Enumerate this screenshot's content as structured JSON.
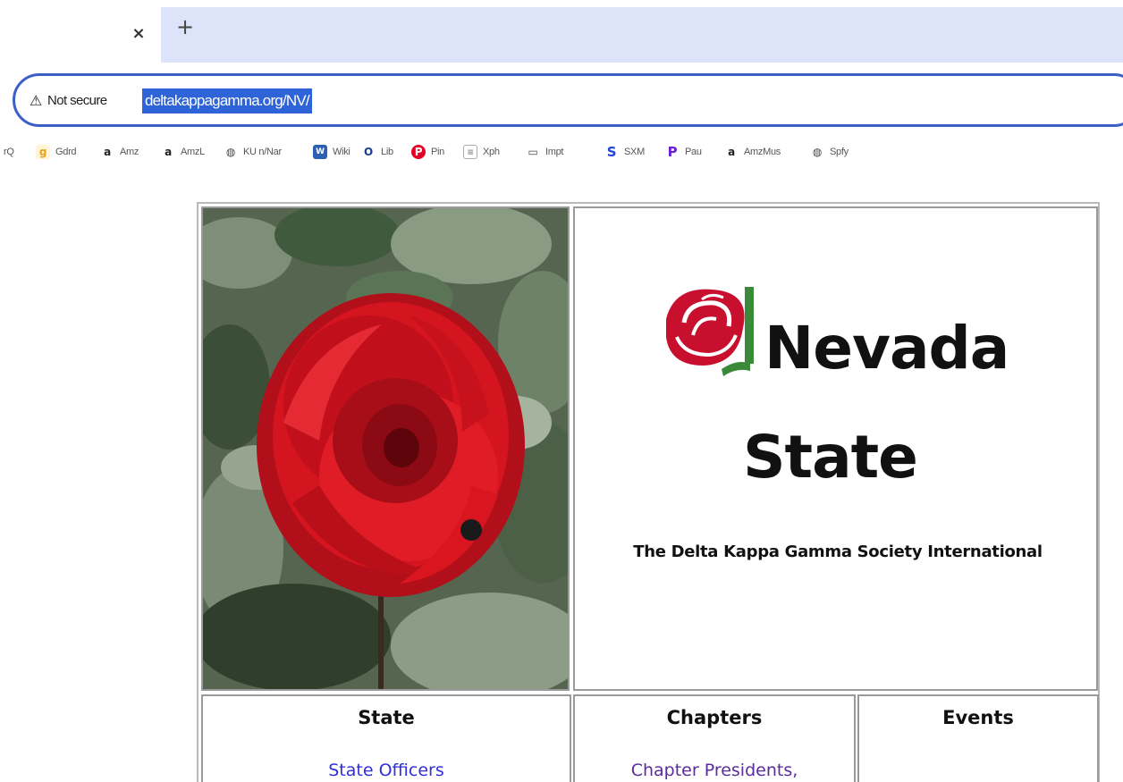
{
  "browser": {
    "tab": {
      "close_glyph": "×",
      "new_tab_glyph": "+"
    },
    "omnibox": {
      "security_icon": "warning-triangle-icon",
      "security_label": "Not secure",
      "url": "deltakappagamma.org/NV/"
    },
    "bookmarks": [
      {
        "label": "rQ",
        "icon": ""
      },
      {
        "label": "Gdrd",
        "icon": "g",
        "color": "#e8a317"
      },
      {
        "label": "Amz",
        "icon": "a",
        "color": "#222222"
      },
      {
        "label": "AmzL",
        "icon": "a",
        "color": "#222222"
      },
      {
        "label": "KU n/Nar",
        "icon": "globe",
        "color": "#444444"
      },
      {
        "label": "Wiki",
        "icon": "W",
        "color": "#2d5fb3"
      },
      {
        "label": "Lib",
        "icon": "O",
        "color": "#1a3d8f"
      },
      {
        "label": "Pin",
        "icon": "P",
        "color": "#e60023"
      },
      {
        "label": "Xph",
        "icon": "doc",
        "color": "#888888"
      },
      {
        "label": "Impt",
        "icon": "folder",
        "color": "#444444"
      },
      {
        "label": "SXM",
        "icon": "S",
        "color": "#1f44d8"
      },
      {
        "label": "Pau",
        "icon": "P",
        "color": "#6b1fd8"
      },
      {
        "label": "AmzMus",
        "icon": "a",
        "color": "#222222"
      },
      {
        "label": "Spfy",
        "icon": "globe",
        "color": "#444444"
      }
    ]
  },
  "site": {
    "brand": {
      "line1": "Nevada",
      "line2": "State",
      "subtitle": "The Delta Kappa Gamma Society International"
    },
    "nav": [
      {
        "heading": "State",
        "link": "State Officers",
        "visited": false
      },
      {
        "heading": "Chapters",
        "link": "Chapter Presidents,",
        "visited": true
      },
      {
        "heading": "Events",
        "link": "",
        "visited": false
      }
    ]
  },
  "colors": {
    "tabstrip": "#dde3f8",
    "omnibox_border": "#3b5fc6",
    "url_highlight": "#2f63d8",
    "link": "#2f2fd8",
    "visited_link": "#5b2b9c",
    "rose_red": "#c8102e",
    "leaf_green": "#3a8a3a"
  }
}
